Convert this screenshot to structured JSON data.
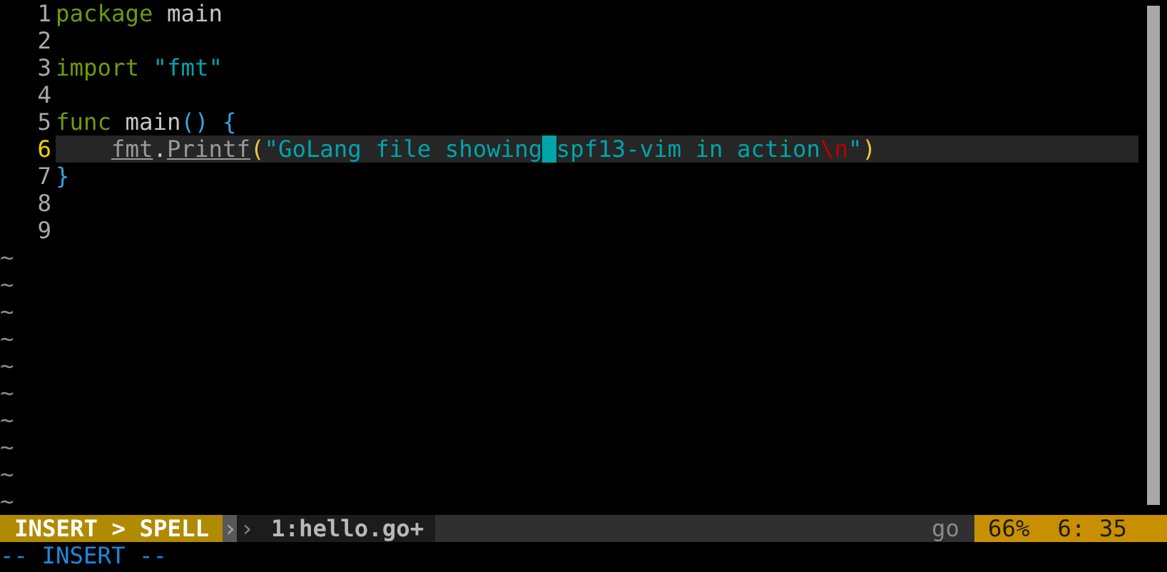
{
  "editor": {
    "lines": [
      {
        "number": "1",
        "current": false,
        "tokens": [
          {
            "kind": "keyword",
            "text": "package"
          },
          {
            "kind": "plain",
            "text": " main"
          }
        ]
      },
      {
        "number": "2",
        "current": false
      },
      {
        "number": "3",
        "current": false,
        "tokens": [
          {
            "kind": "keyword",
            "text": "import"
          },
          {
            "kind": "string",
            "text": " \"fmt\""
          }
        ]
      },
      {
        "number": "4",
        "current": false
      },
      {
        "number": "5",
        "current": false,
        "tokens": [
          {
            "kind": "keyword",
            "text": "func"
          },
          {
            "kind": "plain",
            "text": " main"
          },
          {
            "kind": "brace",
            "text": "() {"
          }
        ]
      },
      {
        "number": "6",
        "current": true,
        "indented": true,
        "tokens": [
          {
            "kind": "link",
            "text": "fmt"
          },
          {
            "kind": "plain",
            "text": "."
          },
          {
            "kind": "link",
            "text": "Printf"
          },
          {
            "kind": "paren",
            "text": "("
          },
          {
            "kind": "string",
            "text": "\"GoLang file showing"
          },
          {
            "kind": "string",
            "text": "spf13-vim in action",
            "cursor_before": true
          },
          {
            "kind": "escape",
            "text": "\\n"
          },
          {
            "kind": "string",
            "text": "\""
          },
          {
            "kind": "paren",
            "text": ")"
          }
        ]
      },
      {
        "number": "7",
        "current": false,
        "tokens": [
          {
            "kind": "brace",
            "text": "}"
          }
        ]
      },
      {
        "number": "8",
        "current": false
      },
      {
        "number": "9",
        "current": false
      }
    ],
    "empty_line_markers": [
      "~",
      "~",
      "~",
      "~",
      "~",
      "~",
      "~",
      "~",
      "~",
      "~"
    ]
  },
  "statusline": {
    "mode": "INSERT > SPELL",
    "separators": [
      "›",
      "›"
    ],
    "file": "1:hello.go+",
    "filetype": "go",
    "percent": "66%",
    "position": "6: 35"
  },
  "command_line": "-- INSERT --"
}
